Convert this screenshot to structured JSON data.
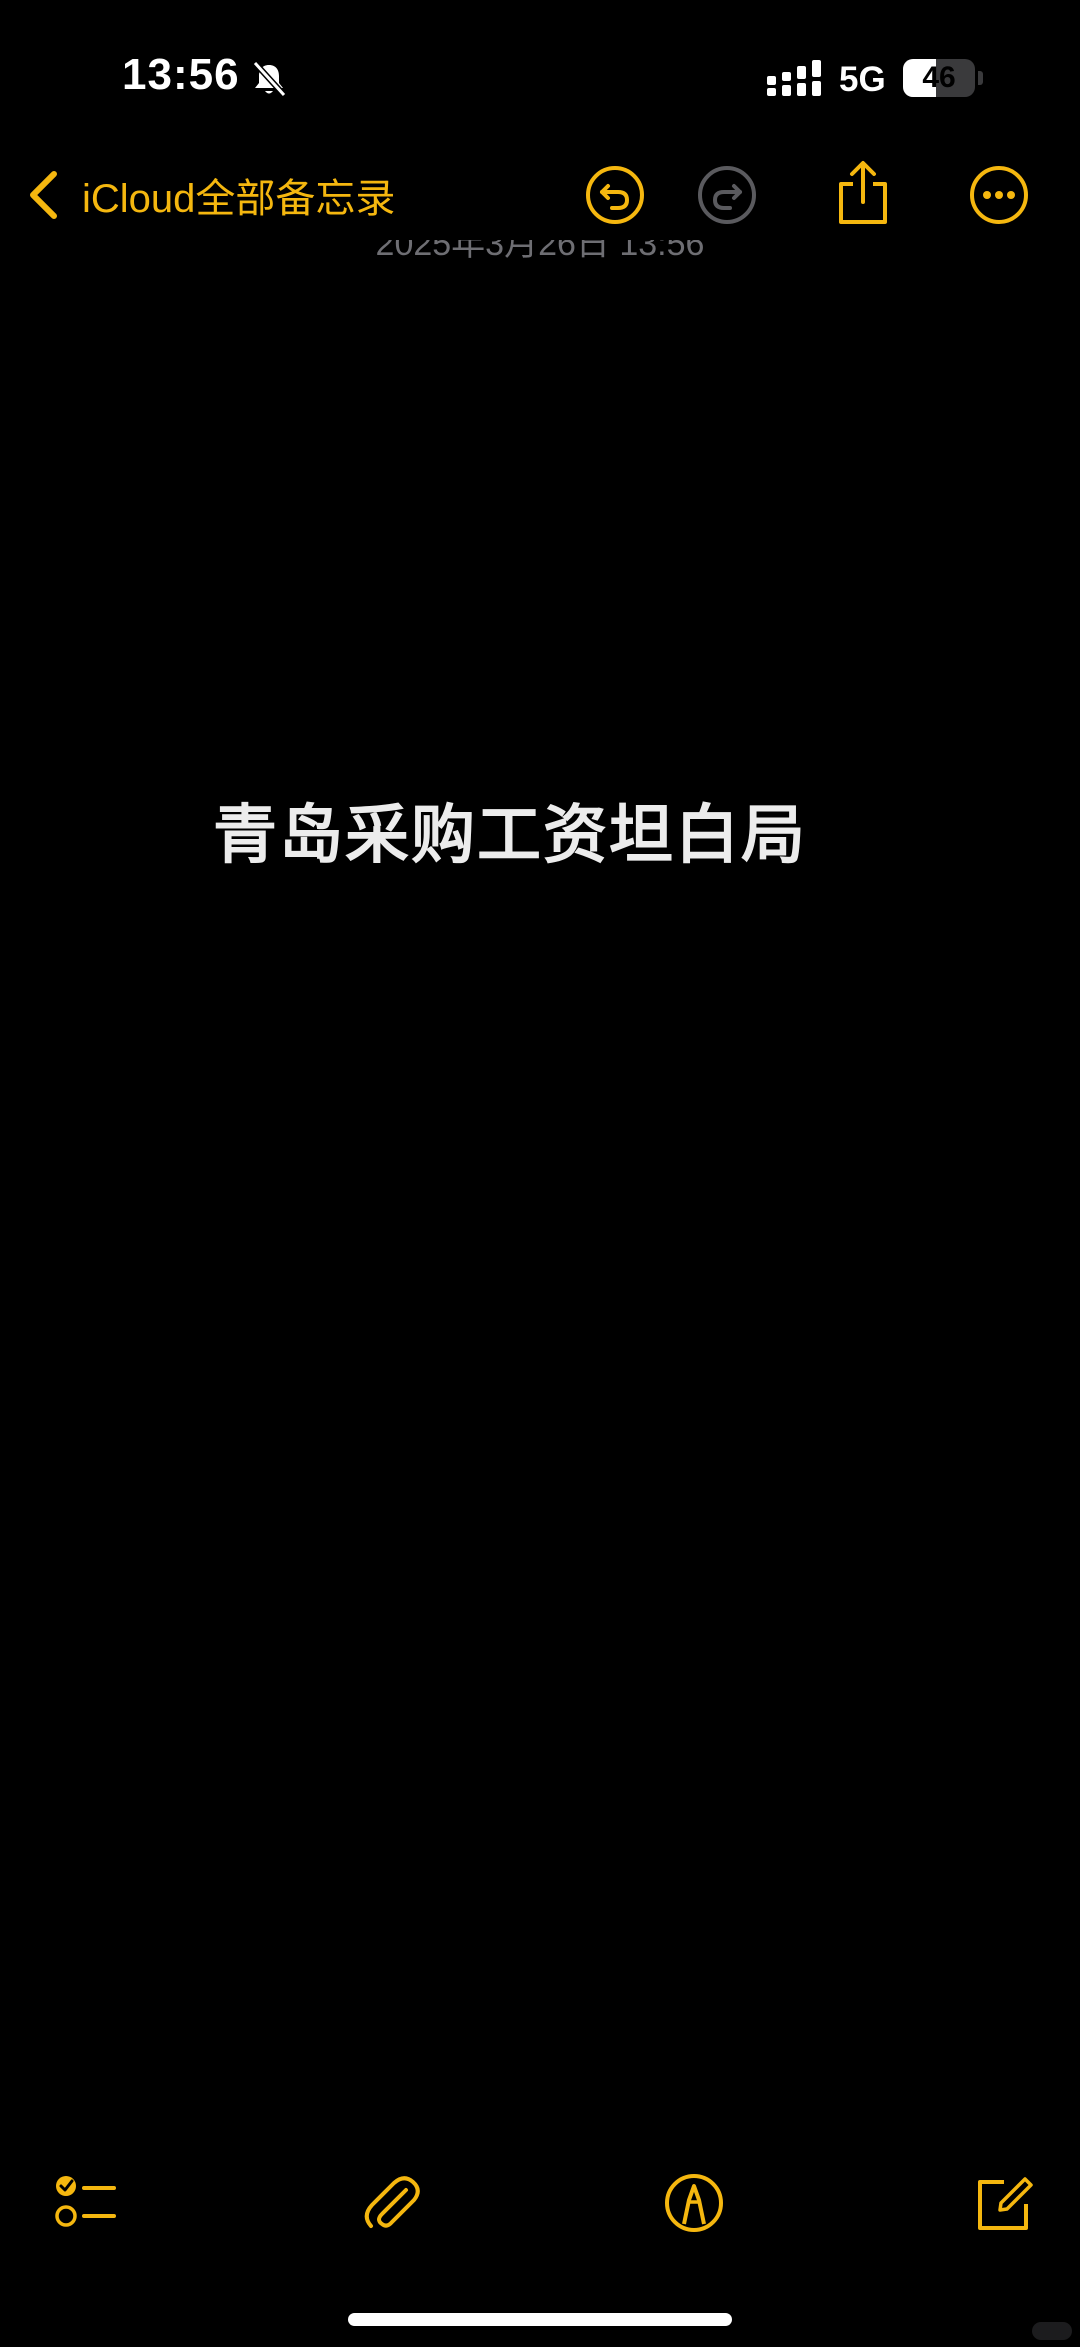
{
  "status_bar": {
    "time": "13:56",
    "network": "5G",
    "battery": "46",
    "battery_level": 0.46,
    "icons": [
      "bell-slash-icon",
      "cellular-signal-icon"
    ]
  },
  "nav": {
    "back_label": "iCloud全部备忘录",
    "back_icon": "chevron-left-icon",
    "actions": [
      "undo-icon",
      "redo-icon",
      "share-icon",
      "more-icon"
    ]
  },
  "note": {
    "date": "2025年3月26日 13:56",
    "title": "青岛采购工资坦白局"
  },
  "toolbar": {
    "items": [
      "checklist-icon",
      "paperclip-icon",
      "markup-pen-icon",
      "compose-icon"
    ]
  },
  "colors": {
    "accent": "#f5b70f",
    "accent_disabled": "#5a5a5e",
    "background": "#000000",
    "text": "#ececec"
  }
}
